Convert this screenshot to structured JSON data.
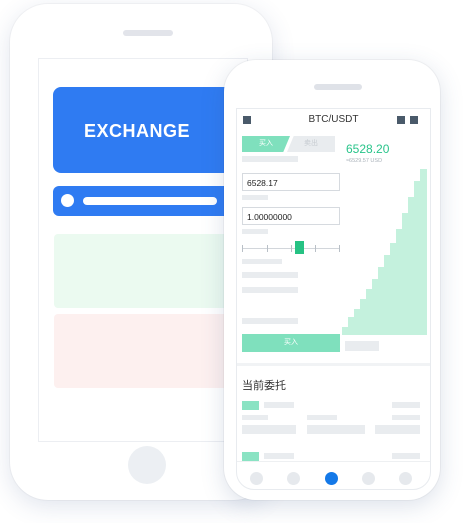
{
  "back_phone": {
    "banner_title": "EXCHANGE"
  },
  "front_phone": {
    "header": {
      "pair": "BTC/USDT"
    },
    "tabs": {
      "buy": "买入",
      "sell": "卖出"
    },
    "price": {
      "last": "6528.20",
      "converted": "≈6529.57 USD"
    },
    "form": {
      "price_value": "6528.17",
      "amount_value": "1.00000000",
      "buy_button": "买入"
    },
    "orders": {
      "title": "当前委托"
    },
    "nav": {
      "active_index": 2,
      "count": 5
    }
  },
  "colors": {
    "brand_blue": "#2f7bf2",
    "buy_green": "#26c283",
    "buy_green_light": "#7fe0bd",
    "nav_active": "#1479e8"
  }
}
